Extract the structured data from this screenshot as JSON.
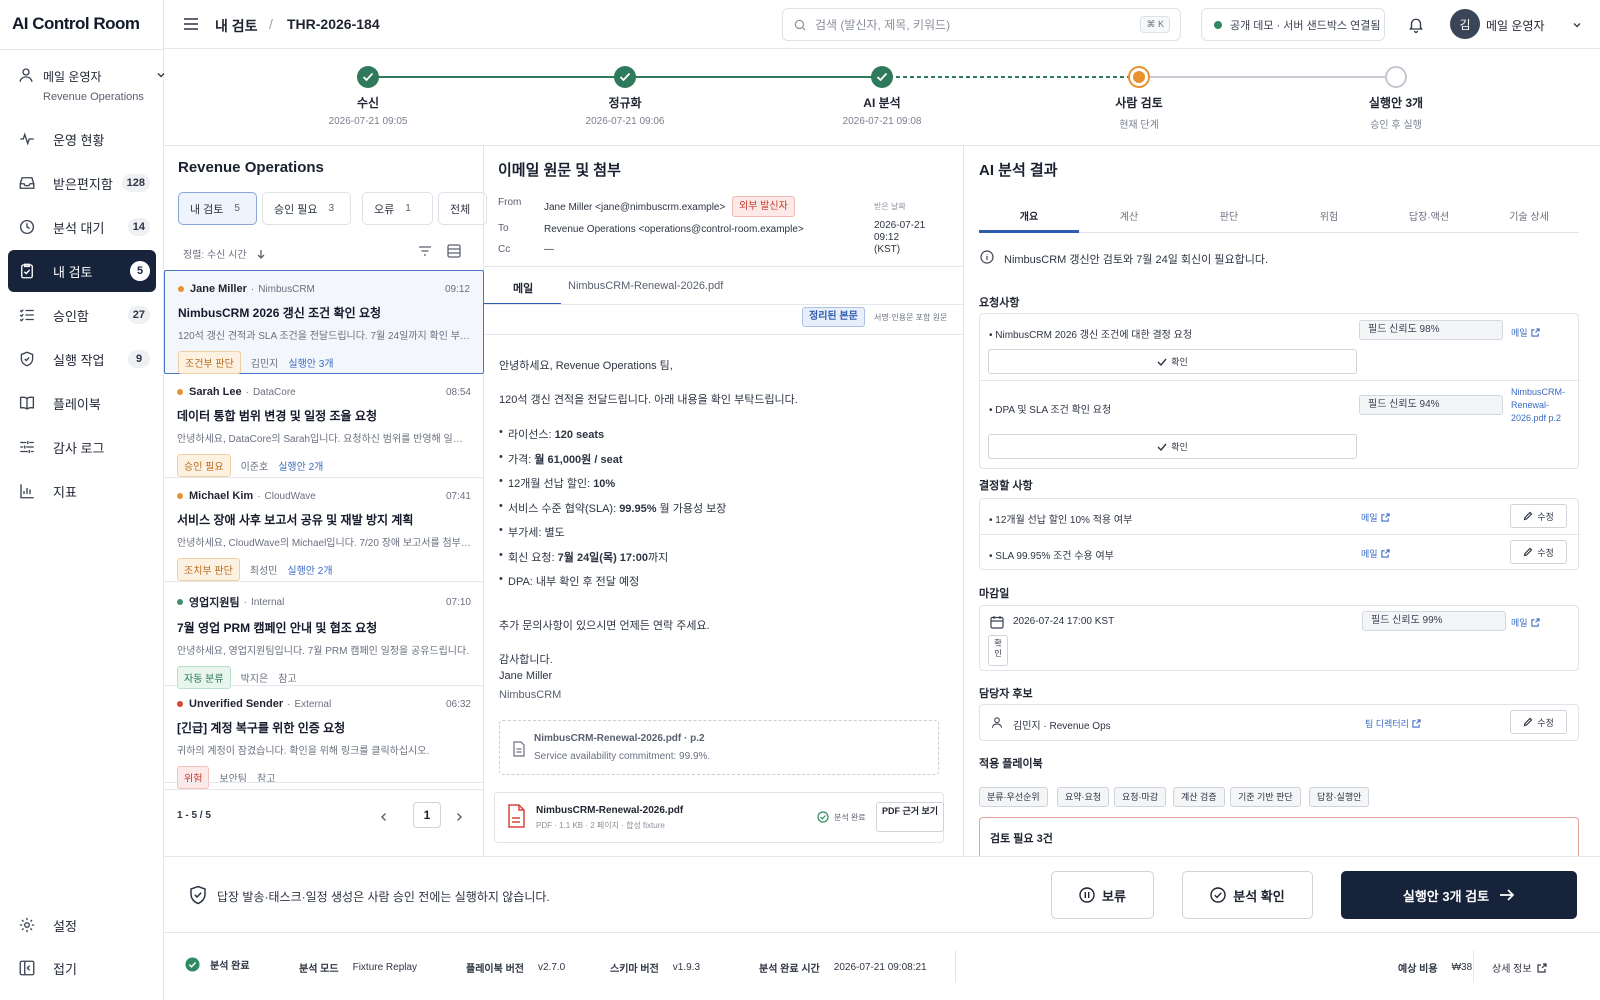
{
  "app": {
    "title": "AI Control Room"
  },
  "user_switcher": {
    "name": "메일 운영자",
    "team": "Revenue Operations"
  },
  "sidebar": {
    "items": [
      {
        "label": "운영 현황",
        "icon": "activity-icon",
        "count": ""
      },
      {
        "label": "받은편지함",
        "icon": "inbox-icon",
        "count": "128"
      },
      {
        "label": "분석 대기",
        "icon": "clock-icon",
        "count": "14"
      },
      {
        "label": "내 검토",
        "icon": "clipboard-check-icon",
        "count": "5"
      },
      {
        "label": "승인함",
        "icon": "list-check-icon",
        "count": "27"
      },
      {
        "label": "실행 작업",
        "icon": "shield-icon",
        "count": "9"
      },
      {
        "label": "플레이북",
        "icon": "book-icon",
        "count": ""
      },
      {
        "label": "감사 로그",
        "icon": "sliders-icon",
        "count": ""
      },
      {
        "label": "지표",
        "icon": "bar-chart-icon",
        "count": ""
      }
    ],
    "settings_label": "설정",
    "collapse_label": "접기"
  },
  "header": {
    "breadcrumb_root": "내 검토",
    "breadcrumb_sep": "/",
    "thread_id": "THR-2026-184",
    "search_placeholder": "검색 (발신자, 제목, 키워드)",
    "search_shortcut": "⌘ K",
    "sandbox_status": "공개 데모 · 서버 샌드박스 연결됨",
    "user_initial": "김",
    "user_name": "메일 운영자"
  },
  "stepper": [
    {
      "label": "수신",
      "time": "2026-07-21 09:05",
      "state": "done"
    },
    {
      "label": "정규화",
      "time": "2026-07-21 09:06",
      "state": "done"
    },
    {
      "label": "AI 분석",
      "time": "2026-07-21 09:08",
      "state": "done"
    },
    {
      "label": "사람 검토",
      "time": "현재 단계",
      "state": "current"
    },
    {
      "label": "실행안 3개",
      "time": "승인 후 실행",
      "state": "todo"
    }
  ],
  "list": {
    "title": "Revenue Operations",
    "filters": [
      {
        "label": "내 검토",
        "count": "5"
      },
      {
        "label": "승인 필요",
        "count": "3"
      },
      {
        "label": "오류",
        "count": "1"
      },
      {
        "label": "전체",
        "count": ""
      }
    ],
    "sort_label": "정렬: 수신 시간",
    "items": [
      {
        "sender": "Jane Miller",
        "org": "NimbusCRM",
        "time": "09:12",
        "dot": "#e8912d",
        "subject": "NimbusCRM 2026 갱신 조건 확인 요청",
        "preview": "120석 갱신 견적과 SLA 조건을 전달드립니다. 7월 24일까지 확인 부탁…",
        "tag": "조건부 판단",
        "tag_color": "orange",
        "owner": "김민지",
        "action": "실행안 3개"
      },
      {
        "sender": "Sarah Lee",
        "org": "DataCore",
        "time": "08:54",
        "dot": "#e8912d",
        "subject": "데이터 통합 범위 변경 및 일정 조율 요청",
        "preview": "안녕하세요, DataCore의 Sarah입니다. 요청하신 범위를 반영해 일정을 …",
        "tag": "승인 필요",
        "tag_color": "orange",
        "owner": "이준호",
        "action": "실행안 2개"
      },
      {
        "sender": "Michael Kim",
        "org": "CloudWave",
        "time": "07:41",
        "dot": "#e8912d",
        "subject": "서비스 장애 사후 보고서 공유 및 재발 방지 계획",
        "preview": "안녕하세요, CloudWave의 Michael입니다. 7/20 장애 보고서를 첨부합…",
        "tag": "조치부 판단",
        "tag_color": "orange",
        "owner": "최성민",
        "action": "실행안 2개"
      },
      {
        "sender": "영업지원팀",
        "org": "Internal",
        "time": "07:10",
        "dot": "#3f8f6b",
        "subject": "7월 영업 PRM 캠페인 안내 및 협조 요청",
        "preview": "안녕하세요, 영업지원팀입니다. 7월 PRM 캠페인 일정을 공유드립니다.",
        "tag": "자동 분류",
        "tag_color": "green",
        "owner": "박지은",
        "action": "참고"
      },
      {
        "sender": "Unverified Sender",
        "org": "External",
        "time": "06:32",
        "dot": "#d9443a",
        "subject": "[긴급] 계정 복구를 위한 인증 요청",
        "preview": "귀하의 계정이 잠겼습니다. 확인을 위해 링크를 클릭하십시오.",
        "tag": "위험",
        "tag_color": "red",
        "owner": "보안팀",
        "action": "참고"
      }
    ],
    "pagination": {
      "range": "1 - 5 / 5",
      "page": "1"
    }
  },
  "email": {
    "title": "이메일 원문 및 첨부",
    "from_label": "From",
    "from": "Jane Miller <jane@nimbuscrm.example>",
    "external_badge": "외부 발신자",
    "to_label": "To",
    "to": "Revenue Operations <operations@control-room.example>",
    "cc_label": "Cc",
    "cc": "—",
    "received_label": "받은 날짜",
    "received_date": "2026-07-21",
    "received_time": "09:12",
    "received_tz": "(KST)",
    "tabs": [
      "메일",
      "NimbusCRM-Renewal-2026.pdf"
    ],
    "view_clean": "정리된 본문",
    "view_full": "서명·인용문 포함 원문",
    "greeting": "안녕하세요, Revenue Operations 팀,",
    "intro": "120석 갱신 견적을 전달드립니다. 아래 내용을 확인 부탁드립니다.",
    "bullets": [
      {
        "k": "라이선스: ",
        "v": "120 seats",
        "s": ""
      },
      {
        "k": "가격: ",
        "v": "월 61,000원 / seat",
        "s": ""
      },
      {
        "k": "12개월 선납 할인: ",
        "v": "10%",
        "s": ""
      },
      {
        "k": "서비스 수준 협약(SLA): ",
        "v": "99.95%",
        "s": " 월 가용성 보장"
      },
      {
        "k": "부가세: 별도",
        "v": "",
        "s": ""
      },
      {
        "k": "회신 요청: ",
        "v": "7월 24일(목) 17:00",
        "s": "까지"
      },
      {
        "k": "DPA: 내부 확인 후 전달 예정",
        "v": "",
        "s": ""
      }
    ],
    "closing": "추가 문의사항이 있으시면 언제든 연락 주세요.",
    "thanks": "감사합니다.",
    "sig_name": "Jane Miller",
    "sig_org": "NimbusCRM",
    "quote_file": "NimbusCRM-Renewal-2026.pdf · p.2",
    "quote_text": "Service availability commitment: 99.9%.",
    "attachment_name": "NimbusCRM-Renewal-2026.pdf",
    "attachment_meta": "PDF · 1.1 KB · 2 페이지 · 합성 fixture",
    "attachment_status": "분석 완료",
    "attachment_btn": "PDF 근거 보기"
  },
  "ai": {
    "title": "AI 분석 결과",
    "tabs": [
      "개요",
      "계산",
      "판단",
      "위험",
      "답장·액션",
      "기술 상세"
    ],
    "notice": "NimbusCRM 갱신안 검토와 7월 24일 회신이 필요합니다.",
    "requests_title": "요청사항",
    "requests": [
      {
        "text": "• NimbusCRM 2026 갱신 조건에 대한 결정 요청",
        "conf": "필드 신뢰도 98%",
        "src": "메일",
        "confirm": "확인"
      },
      {
        "text": "• DPA 및 SLA 조건 확인 요청",
        "conf": "필드 신뢰도 94%",
        "src": "NimbusCRM-Renewal-2026.pdf p.2",
        "confirm": "확인"
      }
    ],
    "decisions_title": "결정할 사항",
    "decisions": [
      {
        "text": "• 12개월 선납 할인 10% 적용 여부",
        "src": "메일",
        "edit": "수정"
      },
      {
        "text": "• SLA 99.95% 조건 수용 여부",
        "src": "메일",
        "edit": "수정"
      }
    ],
    "deadline_title": "마감일",
    "deadline": {
      "value": "2026-07-24 17:00 KST",
      "conf": "필드 신뢰도 99%",
      "src": "메일",
      "confirm": "확인"
    },
    "owner_title": "담당자 후보",
    "owner": {
      "value": "김민지 · Revenue Ops",
      "src": "팀 디렉터리",
      "edit": "수정"
    },
    "playbooks_title": "적용 플레이북",
    "playbooks": [
      "분류·우선순위",
      "요약·요청",
      "요청·마감",
      "계산 검증",
      "기준 기반 판단",
      "답장·실행안"
    ],
    "review_needed": "검토 필요 3건"
  },
  "actionbar": {
    "notice": "답장 발송·태스크·일정 생성은 사람 승인 전에는 실행하지 않습니다.",
    "hold": "보류",
    "confirm": "분석 확인",
    "review": "실행안 3개 검토"
  },
  "statusbar": {
    "status": "분석 완료",
    "mode_label": "분석 모드",
    "mode": "Fixture Replay",
    "playbook_label": "플레이북 버전",
    "playbook": "v2.7.0",
    "schema_label": "스키마 버전",
    "schema": "v1.9.3",
    "time_label": "분석 완료 시간",
    "time": "2026-07-21 09:08:21",
    "cost_label": "예상 비용",
    "cost": "₩38",
    "details": "상세 정보"
  },
  "colors": {
    "navy": "#17223b",
    "accent": "#e8912d",
    "green": "#2f8a62",
    "link": "#3a6bc4"
  }
}
